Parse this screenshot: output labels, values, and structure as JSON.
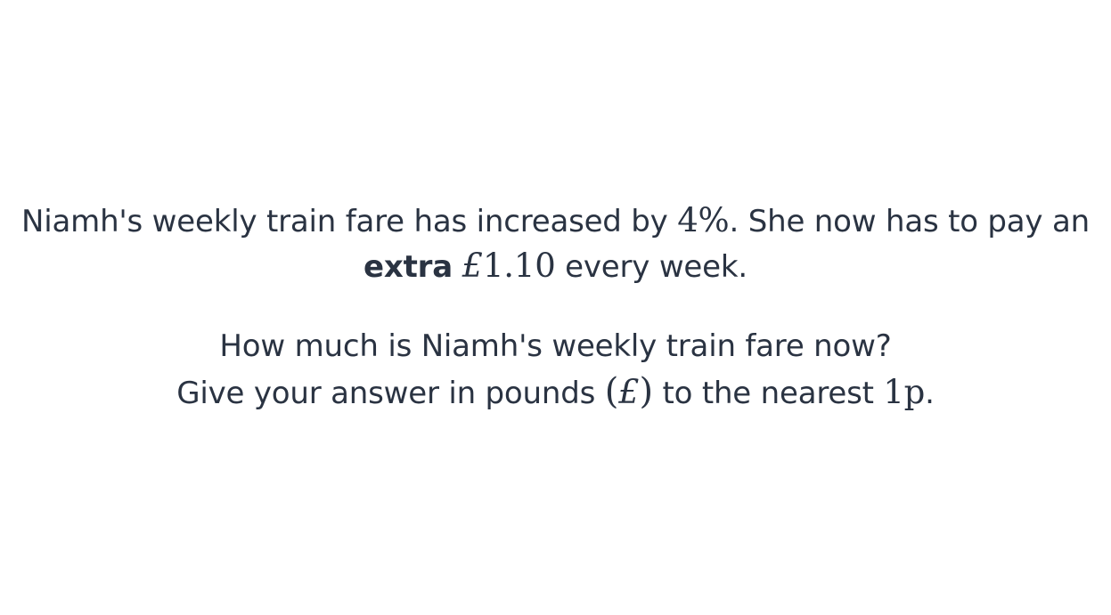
{
  "question": {
    "line1": {
      "text_a": "Niamh's weekly train fare has increased by ",
      "percent": "4%",
      "text_b": ". She now has to pay an"
    },
    "line2": {
      "bold": "extra",
      "pound_sign": "£",
      "amount": "1.10",
      "text": " every week."
    },
    "line3": "How much is Niamh's weekly train fare now?",
    "line4": {
      "text_a": "Give your answer in pounds ",
      "paren_open": "(",
      "pound_sign": "£",
      "paren_close": ")",
      "text_b": " to the nearest ",
      "precision": "1p",
      "text_c": "."
    }
  }
}
